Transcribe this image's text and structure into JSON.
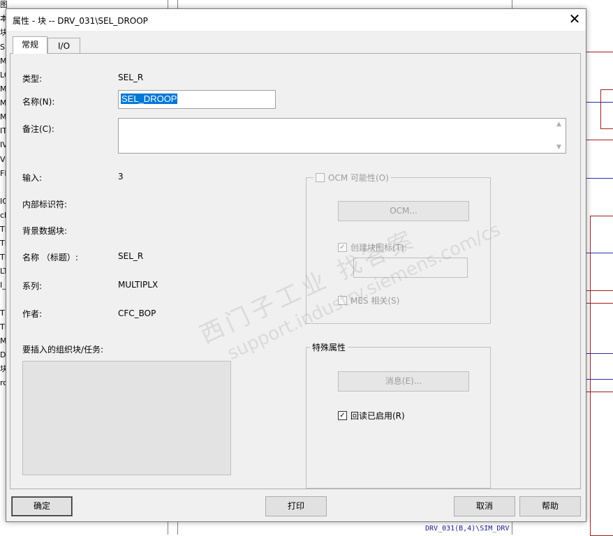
{
  "background": {
    "left_strip": [
      "图表",
      "本",
      "块",
      "S",
      "M",
      "LO",
      "MI",
      "MP",
      "M_",
      "IT",
      "IV",
      "VE",
      "FL",
      "",
      "IO",
      "cl",
      "TH",
      "TH",
      "TH",
      "LT",
      "I_",
      "",
      "T",
      "TE",
      "M",
      "D_",
      "块",
      "ro"
    ],
    "caption": "DRV_031(B,4)\\SIM_DRV"
  },
  "dialog": {
    "title": "属性 - 块 -- DRV_031\\SEL_DROOP",
    "close_symbol": "✕",
    "tabs": [
      {
        "label": "常规",
        "active": true
      },
      {
        "label": "I/O",
        "active": false
      }
    ],
    "general": {
      "type_label": "类型:",
      "type_value": "SEL_R",
      "name_label": "名称(N):",
      "name_value": "SEL_DROOP",
      "comment_label": "备注(C):",
      "comment_value": "",
      "inputs_label": "输入:",
      "inputs_value": "3",
      "internal_id_label": "内部标识符:",
      "internal_id_value": "",
      "instance_db_label": "背景数据块:",
      "instance_db_value": "",
      "header_name_label": "名称 （标题）:",
      "header_name_value": "SEL_R",
      "family_label": "系列:",
      "family_value": "MULTIPLX",
      "author_label": "作者:",
      "author_value": "CFC_BOP",
      "insert_ob_label": "要插入的组织块/任务:",
      "insert_ob_items": []
    },
    "ocm_group": {
      "legend": "OCM 可能性(O)",
      "legend_checked": false,
      "ocm_button": "OCM...",
      "create_icon_label": "创建块图标(T):",
      "create_icon_checked": true,
      "create_icon_value": "",
      "mes_label": "MES 相关(S)",
      "mes_checked": false
    },
    "special_group": {
      "legend": "特殊属性",
      "message_button": "消息(E)...",
      "readback_label": "回读已启用(R)",
      "readback_checked": true
    },
    "footer": {
      "ok": "确定",
      "print": "打印",
      "cancel": "取消",
      "help": "帮助"
    },
    "watermark": {
      "line1": "西门子工业  找答案",
      "line2": "support.industry.siemens.com/cs"
    }
  }
}
